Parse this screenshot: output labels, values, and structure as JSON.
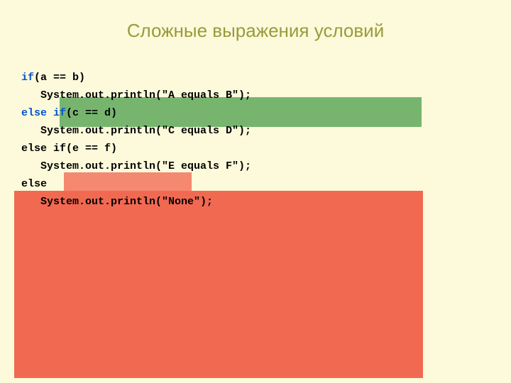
{
  "title": "Сложные выражения условий",
  "code": {
    "line1_kw": "if",
    "line1_rest": "(a == b)",
    "line2": "   System.out.println(\"A equals B\");",
    "line3_kw": "else if",
    "line3_rest": "(c == d)",
    "line4": "   System.out.println(\"C equals D\");",
    "line5": "else if(e == f)",
    "line6": "   System.out.println(\"E equals F\");",
    "line7": "else",
    "line8": "   System.out.println(\"None\");"
  }
}
